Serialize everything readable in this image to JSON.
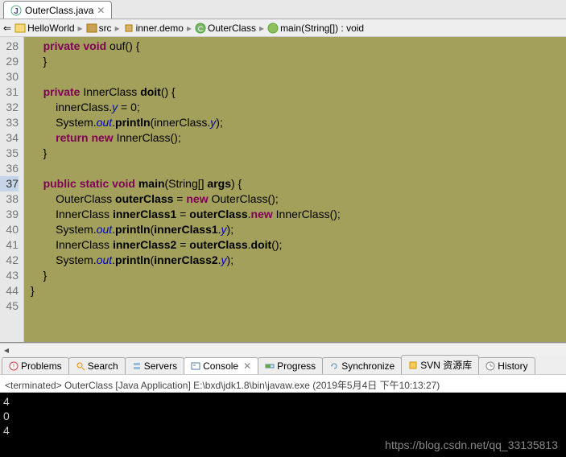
{
  "tab": {
    "filename": "OuterClass.java"
  },
  "breadcrumb": {
    "project": "HelloWorld",
    "src": "src",
    "pkg": "inner.demo",
    "class": "OuterClass",
    "method": "main(String[]) : void"
  },
  "gutter": {
    "start": 28,
    "end": 45,
    "current": 37
  },
  "code_lines": [
    "    private void ouf() {",
    "    }",
    "",
    "    private InnerClass doit() {",
    "        innerClass.y = 0;",
    "        System.out.println(innerClass.y);",
    "        return new InnerClass();",
    "    }",
    "",
    "    public static void main(String[] args) {",
    "        OuterClass outerClass = new OuterClass();",
    "        InnerClass innerClass1 = outerClass.new InnerClass();",
    "        System.out.println(innerClass1.y);",
    "        InnerClass innerClass2 = outerClass.doit();",
    "        System.out.println(innerClass2.y);",
    "    }",
    "}",
    ""
  ],
  "bottom_tabs": {
    "problems": "Problems",
    "search": "Search",
    "servers": "Servers",
    "console": "Console",
    "progress": "Progress",
    "synchronize": "Synchronize",
    "svn": "SVN 资源库",
    "history": "History"
  },
  "console": {
    "status": "<terminated> OuterClass [Java Application] E:\\bxd\\jdk1.8\\bin\\javaw.exe (2019年5月4日 下午10:13:27)",
    "output": [
      "4",
      "0",
      "4"
    ]
  },
  "watermark": "https://blog.csdn.net/qq_33135813"
}
